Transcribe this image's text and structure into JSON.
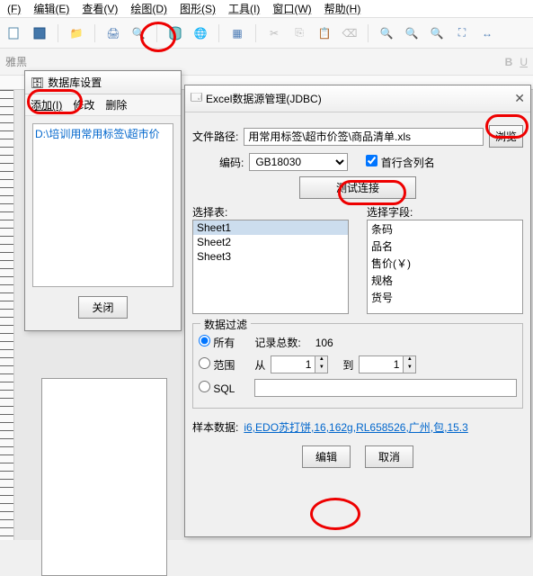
{
  "menu": {
    "file": "(F)",
    "edit": "编辑(E)",
    "view": "查看(V)",
    "draw": "绘图(D)",
    "shape": "图形(S)",
    "tool": "工具(I)",
    "window": "窗口(W)",
    "help": "帮助(H)"
  },
  "dbDlg": {
    "title": "数据库设置",
    "add": "添加(I)",
    "modify": "修改",
    "delete": "删除",
    "path": "D:\\培训用常用标签\\超市价",
    "close": "关闭"
  },
  "excelDlg": {
    "title": "Excel数据源管理(JDBC)",
    "filePathLabel": "文件路径:",
    "filePath": "用常用标签\\超市价签\\商品清单.xls",
    "browse": "浏览",
    "encodingLabel": "编码:",
    "encoding": "GB18030",
    "firstRow": "首行含列名",
    "test": "测试连接",
    "selectTable": "选择表:",
    "selectField": "选择字段:",
    "sheets": [
      "Sheet1",
      "Sheet2",
      "Sheet3"
    ],
    "fields": [
      "条码",
      "品名",
      "售价(￥)",
      "规格",
      "货号"
    ],
    "filter": {
      "legend": "数据过滤",
      "all": "所有",
      "range": "范围",
      "sql": "SQL",
      "countLabel": "记录总数:",
      "count": "106",
      "from": "从",
      "fromVal": "1",
      "to": "到",
      "toVal": "1"
    },
    "sampleLabel": "样本数据:",
    "sample": "i6,EDO苏打饼,16,162g,RL658526,广州,包,15.3",
    "edit": "编辑",
    "cancel": "取消"
  }
}
